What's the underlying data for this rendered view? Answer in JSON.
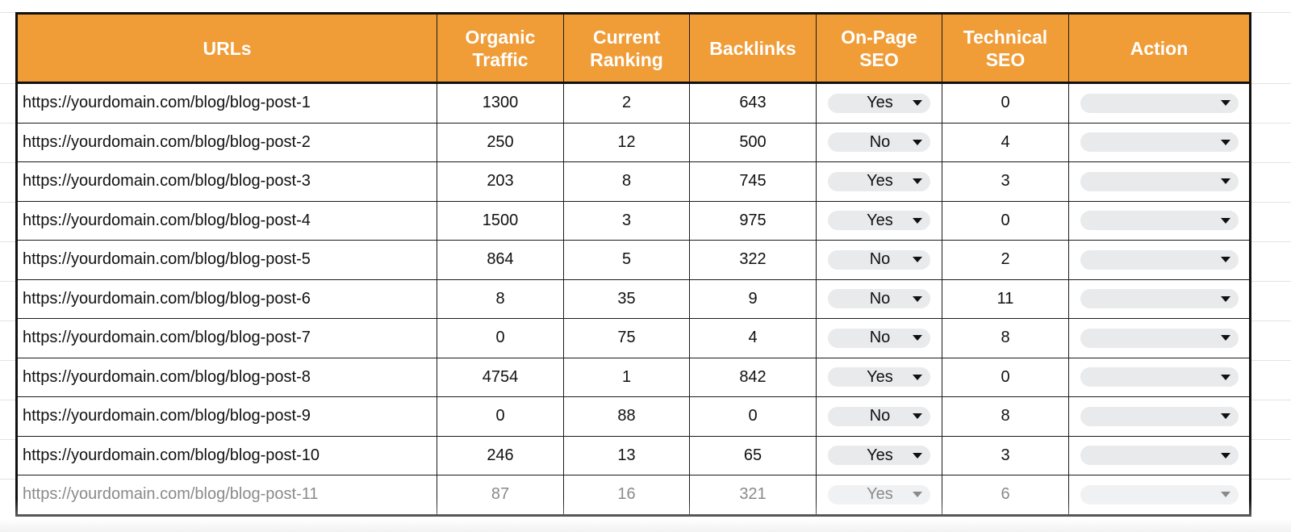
{
  "table": {
    "headers": {
      "url": "URLs",
      "organic_traffic": "Organic Traffic",
      "current_ranking": "Current Ranking",
      "backlinks": "Backlinks",
      "on_page_seo": "On-Page SEO",
      "technical_seo": "Technical SEO",
      "action": "Action"
    },
    "rows": [
      {
        "url": "https://yourdomain.com/blog/blog-post-1",
        "organic_traffic": "1300",
        "current_ranking": "2",
        "backlinks": "643",
        "on_page_seo": "Yes",
        "technical_seo": "0",
        "action": ""
      },
      {
        "url": "https://yourdomain.com/blog/blog-post-2",
        "organic_traffic": "250",
        "current_ranking": "12",
        "backlinks": "500",
        "on_page_seo": "No",
        "technical_seo": "4",
        "action": ""
      },
      {
        "url": "https://yourdomain.com/blog/blog-post-3",
        "organic_traffic": "203",
        "current_ranking": "8",
        "backlinks": "745",
        "on_page_seo": "Yes",
        "technical_seo": "3",
        "action": ""
      },
      {
        "url": "https://yourdomain.com/blog/blog-post-4",
        "organic_traffic": "1500",
        "current_ranking": "3",
        "backlinks": "975",
        "on_page_seo": "Yes",
        "technical_seo": "0",
        "action": ""
      },
      {
        "url": "https://yourdomain.com/blog/blog-post-5",
        "organic_traffic": "864",
        "current_ranking": "5",
        "backlinks": "322",
        "on_page_seo": "No",
        "technical_seo": "2",
        "action": ""
      },
      {
        "url": "https://yourdomain.com/blog/blog-post-6",
        "organic_traffic": "8",
        "current_ranking": "35",
        "backlinks": "9",
        "on_page_seo": "No",
        "technical_seo": "11",
        "action": ""
      },
      {
        "url": "https://yourdomain.com/blog/blog-post-7",
        "organic_traffic": "0",
        "current_ranking": "75",
        "backlinks": "4",
        "on_page_seo": "No",
        "technical_seo": "8",
        "action": ""
      },
      {
        "url": "https://yourdomain.com/blog/blog-post-8",
        "organic_traffic": "4754",
        "current_ranking": "1",
        "backlinks": "842",
        "on_page_seo": "Yes",
        "technical_seo": "0",
        "action": ""
      },
      {
        "url": "https://yourdomain.com/blog/blog-post-9",
        "organic_traffic": "0",
        "current_ranking": "88",
        "backlinks": "0",
        "on_page_seo": "No",
        "technical_seo": "8",
        "action": ""
      },
      {
        "url": "https://yourdomain.com/blog/blog-post-10",
        "organic_traffic": "246",
        "current_ranking": "13",
        "backlinks": "65",
        "on_page_seo": "Yes",
        "technical_seo": "3",
        "action": ""
      },
      {
        "url": "https://yourdomain.com/blog/blog-post-11",
        "organic_traffic": "87",
        "current_ranking": "16",
        "backlinks": "321",
        "on_page_seo": "Yes",
        "technical_seo": "6",
        "action": ""
      }
    ]
  },
  "colors": {
    "header_bg": "#f09d38",
    "header_text": "#ffffff",
    "dropdown_bg": "#e9eaec"
  },
  "icons": {
    "dropdown": "caret-down-icon"
  }
}
